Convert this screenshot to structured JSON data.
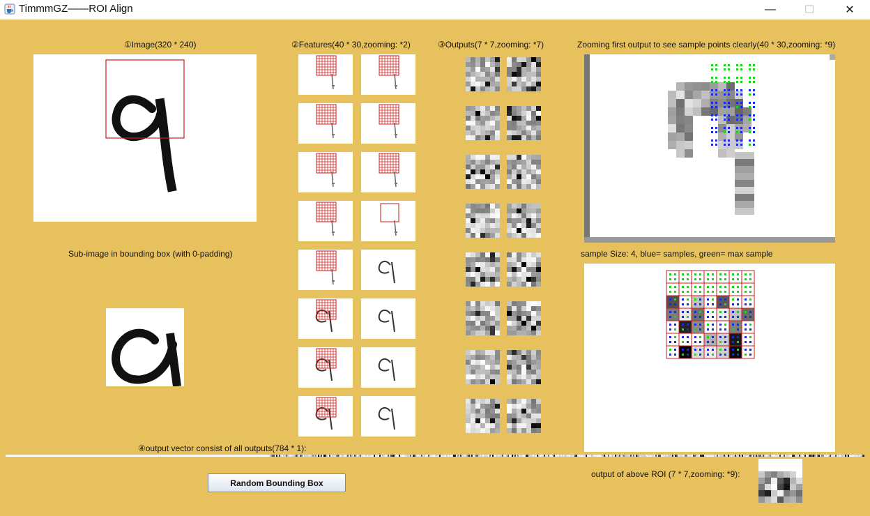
{
  "window": {
    "title": "TimmmGZ——ROI Align",
    "minimize_glyph": "—",
    "maximize_glyph": "☐",
    "close_glyph": "✕",
    "icon": "java-cup-icon"
  },
  "sections": {
    "image": "①Image(320 * 240)",
    "features": "②Features(40 * 30,zooming: *2)",
    "outputs": "③Outputs(7 * 7,zooming: *7)",
    "zooming": "Zooming first output to see sample points clearly(40 * 30,zooming: *9)",
    "subimage": "Sub-image in bounding box (with 0-padding)",
    "sample_info": "sample Size: 4, blue= samples, green= max sample",
    "vector": "④output vector consist of all outputs(784 * 1):",
    "roi_output": "output of above ROI (7 * 7,zooming: *9):"
  },
  "controls": {
    "random_button": "Random Bounding Box"
  },
  "colors": {
    "background": "#e8c15f",
    "bbox": "#d21a1a",
    "sample_blue": "#1c2bd6",
    "sample_green": "#1fd41f"
  }
}
